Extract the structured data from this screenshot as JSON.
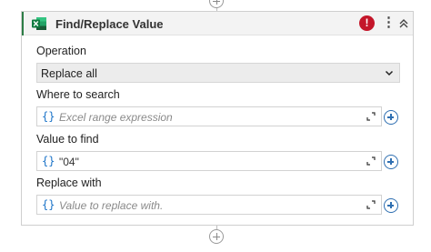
{
  "activity": {
    "title": "Find/Replace Value",
    "icon": "excel-icon",
    "status_icon": "error-icon",
    "menu_icon": "more-vertical-icon",
    "collapse_icon": "chevron-up-double-icon"
  },
  "operation": {
    "label": "Operation",
    "value": "Replace all"
  },
  "where_to_search": {
    "label": "Where to search",
    "value": "",
    "placeholder": "Excel range expression"
  },
  "value_to_find": {
    "label": "Value to find",
    "value": "\"04\"",
    "placeholder": ""
  },
  "replace_with": {
    "label": "Replace with",
    "value": "",
    "placeholder": "Value to replace with."
  },
  "glyphs": {
    "braces": "{}",
    "error": "!",
    "menu": "⋮"
  },
  "colors": {
    "accent": "#2d7d46",
    "error": "#c4162a",
    "link": "#2f6fb1"
  }
}
